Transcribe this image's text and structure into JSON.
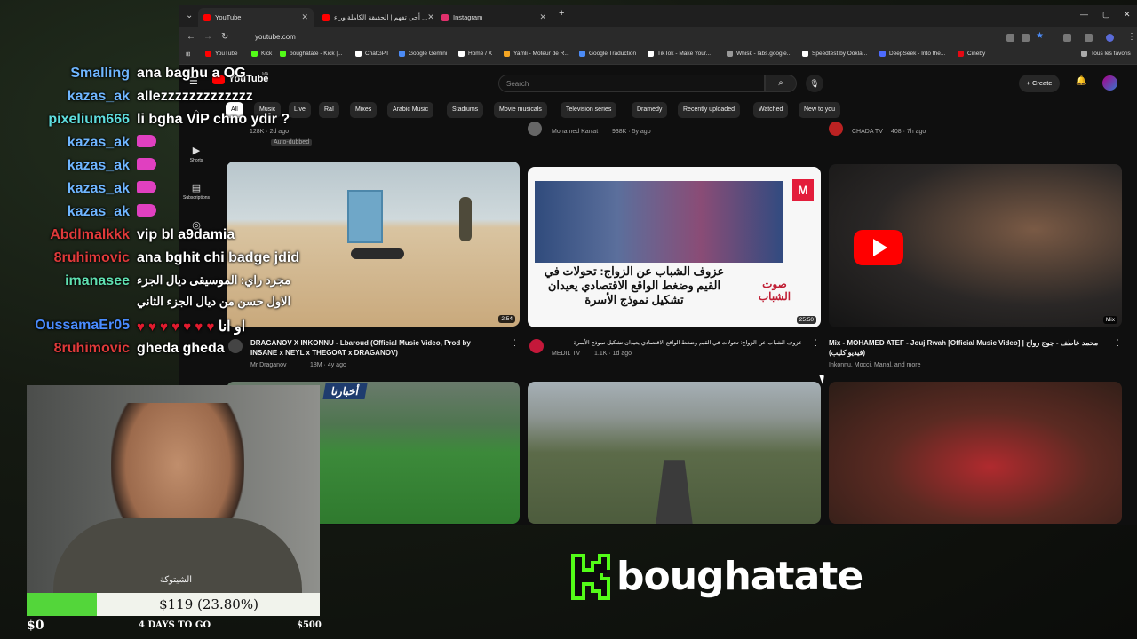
{
  "browser": {
    "tabs": [
      {
        "label": "YouTube",
        "active": true,
        "color": "#ff0000"
      },
      {
        "label": "أجي تفهم | الحقيقة الكاملة وراء ...",
        "active": false,
        "color": "#ff0000"
      },
      {
        "label": "Instagram",
        "active": false,
        "color": "#e1306c"
      }
    ],
    "new_tab": "+",
    "url": "youtube.com",
    "bookmarks": [
      {
        "label": "YouTube",
        "color": "#ff0000"
      },
      {
        "label": "Kick",
        "color": "#53fc18"
      },
      {
        "label": "boughatate - Kick |...",
        "color": "#53fc18"
      },
      {
        "label": "ChatGPT",
        "color": "#ffffff"
      },
      {
        "label": "Google Gemini",
        "color": "#4c8bf5"
      },
      {
        "label": "Home / X",
        "color": "#ffffff"
      },
      {
        "label": "Yamli - Moteur de R...",
        "color": "#f5a623"
      },
      {
        "label": "Google Traduction",
        "color": "#4c8bf5"
      },
      {
        "label": "TikTok - Make Your...",
        "color": "#ffffff"
      },
      {
        "label": "Whisk - labs.google...",
        "color": "#999999"
      },
      {
        "label": "Speedtest by Ookla...",
        "color": "#ffffff"
      },
      {
        "label": "DeepSeek - Into the...",
        "color": "#4d6bfe"
      },
      {
        "label": "Cineby",
        "color": "#e50914"
      }
    ],
    "all_bookmarks": "Tous les favoris"
  },
  "youtube": {
    "logo": "YouTube",
    "country": "MA",
    "search_placeholder": "Search",
    "create_label": "Create",
    "chips": [
      "All",
      "Music",
      "Live",
      "Raï",
      "Mixes",
      "Arabic Music",
      "Stadiums",
      "Movie musicals",
      "Television series",
      "Dramedy",
      "Recently uploaded",
      "Watched",
      "New to you"
    ],
    "sidebar": [
      {
        "label": "Home",
        "icon": "home-icon"
      },
      {
        "label": "Shorts",
        "icon": "shorts-icon"
      },
      {
        "label": "Subscriptions",
        "icon": "subscriptions-icon"
      },
      {
        "label": "You",
        "icon": "user-icon"
      }
    ],
    "top_row": [
      {
        "channel": "2M TV",
        "meta": "128K · 2d ago",
        "badge": "Auto-dubbed"
      },
      {
        "channel": "Mohamed Karrat",
        "meta": "938K · 5y ago"
      },
      {
        "channel": "CHADA TV",
        "meta": "408 · 7h ago"
      }
    ],
    "videos": [
      {
        "title": "DRAGANOV X INKONNU - Lbaroud (Official Music Video, Prod by INSANE x NEYL x THEGOAT x DRAGANOV)",
        "channel": "Mr Draganov",
        "meta": "18M · 4y ago",
        "duration": "2:54"
      },
      {
        "title": "عزوف الشباب عن الزواج: تحولات في القيم وضغط الواقع الاقتصادي يعيدان تشكيل نموذج الأسرة",
        "channel": "MEDI1 TV",
        "meta": "1.1K · 1d ago",
        "duration": "25:50",
        "thumb_text": "عزوف الشباب عن الزواج: تحولات في القيم وضغط الواقع الاقتصادي يعيدان تشكيل نموذج الأسرة",
        "thumb_brand": "صوت الشباب"
      },
      {
        "title": "Mix - MOHAMED ATEF - Jouj Rwah [Official Music Video] | محمد عاطف - جوج رواح (فيديو كليب)",
        "channel": "Inkonnu, Mocci, Manal, and more",
        "meta": "",
        "duration": "Mix"
      }
    ],
    "bottom_thumb_text": "أخبارنا"
  },
  "chat": [
    {
      "user": "Smalling",
      "color": "#6fb6ff",
      "text": "ana baghu a OG"
    },
    {
      "user": "kazas_ak",
      "color": "#6fb6ff",
      "text": "allezzzzzzzzzzzzz"
    },
    {
      "user": "pixelium666",
      "color": "#5fe0e0",
      "text": "li bgha VIP chno ydir ?"
    },
    {
      "user": "kazas_ak",
      "color": "#6fb6ff",
      "text": "",
      "emote": true
    },
    {
      "user": "kazas_ak",
      "color": "#6fb6ff",
      "text": "",
      "emote": true
    },
    {
      "user": "kazas_ak",
      "color": "#6fb6ff",
      "text": "",
      "emote": true
    },
    {
      "user": "kazas_ak",
      "color": "#6fb6ff",
      "text": "",
      "emote": true
    },
    {
      "user": "Abdlmalkkk",
      "color": "#e03a3a",
      "text": "vip bl a9damia"
    },
    {
      "user": "8ruhimovic",
      "color": "#e03a3a",
      "text": "ana bghit chi badge jdid"
    },
    {
      "user": "imanasee",
      "color": "#5fe0b0",
      "text": "مجرد راي: الموسيقى ديال الجزء"
    },
    {
      "user": "",
      "color": "#ffffff",
      "text": "الاول حسن من ديال الجزء الثاني"
    },
    {
      "user": "OussamaEr05",
      "color": "#4a8cff",
      "text": "او انا",
      "hearts": true
    },
    {
      "user": "8ruhimovic",
      "color": "#e03a3a",
      "text": "gheda gheda"
    }
  ],
  "webcam": {
    "caption": "الشيتوكة"
  },
  "goal": {
    "label": "$119 (23.80%)",
    "progress": 0.238,
    "min": "$0",
    "max": "$500",
    "days": "4 DAYS TO GO"
  },
  "brand": {
    "name": "boughatate",
    "color": "#53fc18"
  }
}
